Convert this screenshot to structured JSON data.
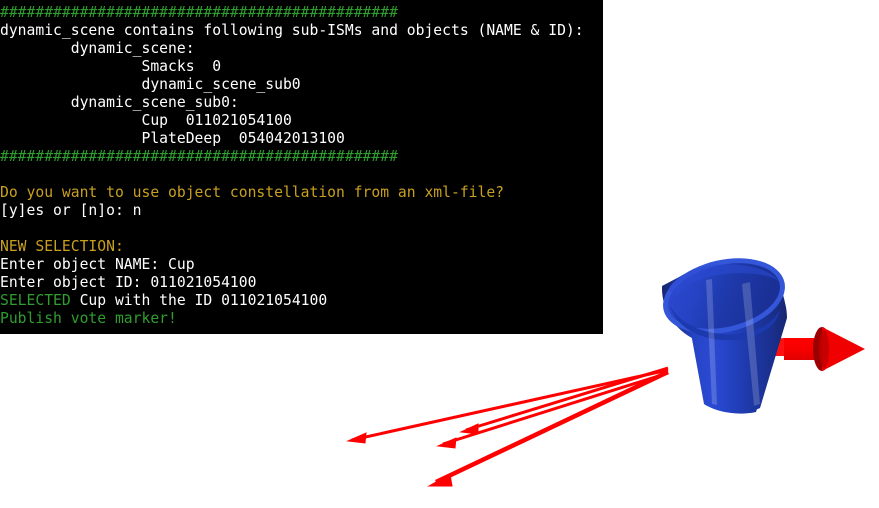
{
  "terminal": {
    "background": "#000000",
    "colors": {
      "white": "#ffffff",
      "green": "#2f9e2f",
      "amber": "#c8a020"
    },
    "lines": [
      {
        "id": "rule-top",
        "color": "green",
        "text": "#############################################"
      },
      {
        "id": "header",
        "color": "white",
        "text": "dynamic_scene contains following sub-ISMs and objects (NAME & ID):"
      },
      {
        "id": "scene-label",
        "color": "white",
        "text": "        dynamic_scene:"
      },
      {
        "id": "smacks-entry",
        "color": "white",
        "text": "                Smacks  0"
      },
      {
        "id": "sub0-entry",
        "color": "white",
        "text": "                dynamic_scene_sub0"
      },
      {
        "id": "sub0-label",
        "color": "white",
        "text": "        dynamic_scene_sub0:"
      },
      {
        "id": "cup-entry",
        "color": "white",
        "text": "                Cup  011021054100"
      },
      {
        "id": "platedeep-entry",
        "color": "white",
        "text": "                PlateDeep  054042013100"
      },
      {
        "id": "rule-bottom",
        "color": "green",
        "text": "#############################################"
      },
      {
        "id": "blank-1",
        "color": "white",
        "text": ""
      },
      {
        "id": "question",
        "color": "amber",
        "text": "Do you want to use object constellation from an xml-file?"
      },
      {
        "id": "prompt-yn",
        "color": "white",
        "text": "[y]es or [n]o: n"
      },
      {
        "id": "blank-2",
        "color": "white",
        "text": ""
      },
      {
        "id": "new-selection",
        "color": "amber",
        "text": "NEW SELECTION:"
      },
      {
        "id": "enter-name",
        "color": "white",
        "text": "Enter object NAME: Cup"
      },
      {
        "id": "enter-id",
        "color": "white",
        "text": "Enter object ID: 011021054100"
      },
      {
        "id": "selected-line",
        "color": "mixed",
        "segments": [
          {
            "color": "green",
            "text": "SELECTED"
          },
          {
            "color": "white",
            "text": " Cup with the ID 011021054100"
          }
        ]
      },
      {
        "id": "publish-line",
        "color": "green",
        "text": "Publish vote marker!"
      }
    ]
  },
  "scene": {
    "label": "3d-object-viewport",
    "background": "#ffffff",
    "objects": {
      "cup": {
        "name": "Cup",
        "id": "011021054100",
        "shape": "cylinder",
        "color_light": "#2a46c8",
        "color_mid": "#1f37a8",
        "color_dark": "#16266f",
        "rim_color": "#3a5ad8"
      },
      "pose_arrow": {
        "name": "pose-orientation-arrow",
        "color": "#f00000",
        "head_color": "#a00000",
        "direction": "right"
      },
      "vote_rays": {
        "name": "vote-marker-rays",
        "color": "#ff0000",
        "count": 4,
        "direction": "down-left"
      }
    }
  }
}
